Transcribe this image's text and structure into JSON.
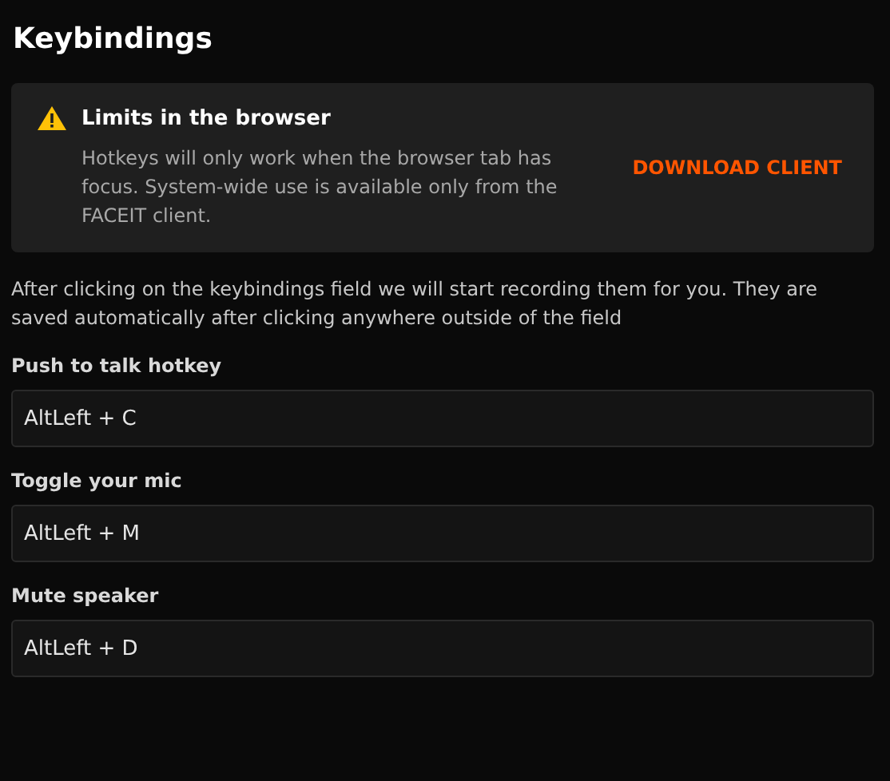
{
  "title": "Keybindings",
  "alert": {
    "title": "Limits in the browser",
    "message": "Hotkeys will only work when the browser tab has focus. System-wide use is available only from the FACEIT client.",
    "action": "DOWNLOAD CLIENT"
  },
  "description": "After clicking on the keybindings field we will start recording them for you. They are saved automatically after clicking anywhere outside of the field",
  "fields": [
    {
      "label": "Push to talk hotkey",
      "value": "AltLeft + C"
    },
    {
      "label": "Toggle your mic",
      "value": "AltLeft + M"
    },
    {
      "label": "Mute speaker",
      "value": "AltLeft + D"
    }
  ]
}
